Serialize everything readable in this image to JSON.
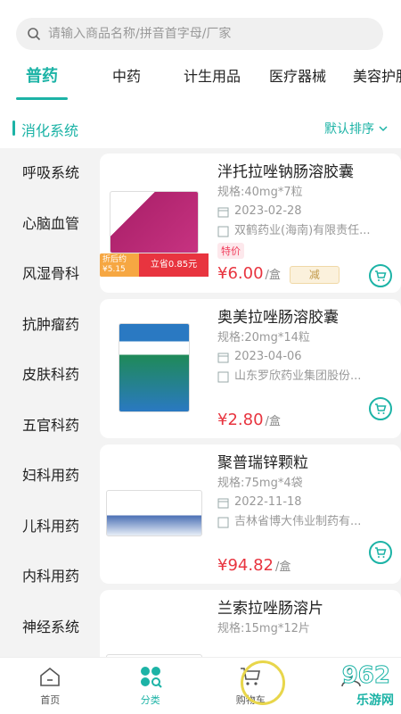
{
  "search": {
    "placeholder": "请输入商品名称/拼音首字母/厂家"
  },
  "tabs": [
    {
      "label": "普药",
      "active": true
    },
    {
      "label": "中药"
    },
    {
      "label": "计生用品"
    },
    {
      "label": "医疗器械"
    },
    {
      "label": "美容护肤"
    }
  ],
  "category": {
    "title": "消化系统",
    "sort_label": "默认排序"
  },
  "sidebar": [
    "呼吸系统",
    "心脑血管",
    "风湿骨科",
    "抗肿瘤药",
    "皮肤科药",
    "五官科药",
    "妇科用药",
    "儿科用药",
    "内科用药",
    "神经系统"
  ],
  "products": [
    {
      "name": "泮托拉唑钠肠溶胶囊",
      "spec": "规格:40mg*7粒",
      "date": "2023-02-28",
      "maker": "双鹤药业(海南)有限责任...",
      "special_tag": "特价",
      "price": "¥6.00",
      "unit": "/盒",
      "minus_tag": "减",
      "promo_left": "折后约 ¥5.15",
      "promo_right": "立省0.85元",
      "pkg_color": "#b0246e"
    },
    {
      "name": "奥美拉唑肠溶胶囊",
      "spec": "规格:20mg*14粒",
      "date": "2023-04-06",
      "maker": "山东罗欣药业集团股份...",
      "price": "¥2.80",
      "unit": "/盒",
      "pkg_color": "#2a79c2"
    },
    {
      "name": "聚普瑞锌颗粒",
      "spec": "规格:75mg*4袋",
      "date": "2022-11-18",
      "maker": "吉林省博大伟业制药有...",
      "price": "¥94.82",
      "unit": "/盒",
      "pkg_color": "#4a6fb5"
    },
    {
      "name": "兰索拉唑肠溶片",
      "spec": "规格:15mg*12片",
      "pkg_color": "#c0453e"
    }
  ],
  "bottom_nav": [
    {
      "label": "首页",
      "icon": "home-icon"
    },
    {
      "label": "分类",
      "icon": "category-icon",
      "active": true
    },
    {
      "label": "购物车",
      "icon": "cart-icon"
    },
    {
      "label": "",
      "icon": "user-icon"
    }
  ],
  "watermark": {
    "text": "962",
    "sub": "乐游网"
  },
  "colors": {
    "accent": "#1cb3a6",
    "price": "#e8343f"
  }
}
